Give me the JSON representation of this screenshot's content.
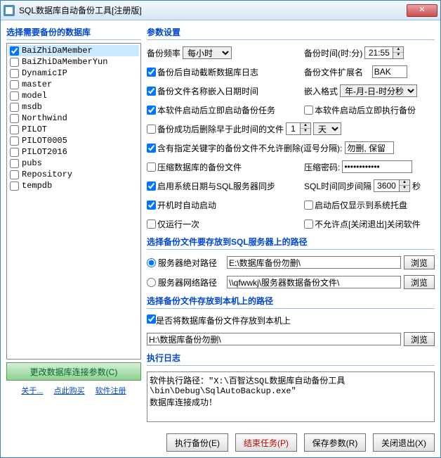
{
  "window": {
    "title": "SQL数据库自动备份工具[注册版]"
  },
  "left": {
    "title": "选择需要备份的数据库",
    "databases": [
      {
        "name": "BaiZhiDaMember",
        "checked": true,
        "selected": true
      },
      {
        "name": "BaiZhiDaMemberYun",
        "checked": false
      },
      {
        "name": "DynamicIP",
        "checked": false
      },
      {
        "name": "master",
        "checked": false
      },
      {
        "name": "model",
        "checked": false
      },
      {
        "name": "msdb",
        "checked": false
      },
      {
        "name": "Northwind",
        "checked": false
      },
      {
        "name": "PILOT",
        "checked": false
      },
      {
        "name": "PILOT0005",
        "checked": false
      },
      {
        "name": "PILOT2016",
        "checked": false
      },
      {
        "name": "pubs",
        "checked": false
      },
      {
        "name": "Repository",
        "checked": false
      },
      {
        "name": "tempdb",
        "checked": false
      }
    ],
    "update_btn": "更改数据库连接参数(C)",
    "links": {
      "about": "关于...",
      "buy": "点此购买",
      "register": "软件注册"
    }
  },
  "params": {
    "title": "参数设置",
    "freq_label": "备份频率",
    "freq_value": "每小时",
    "time_label": "备份时间(时:分)",
    "time_value": "21:55",
    "auto_truncate": "备份后自动截断数据库日志",
    "ext_label": "备份文件扩展名",
    "ext_value": "BAK",
    "embed_datetime": "备份文件名称嵌入日期时间",
    "embed_fmt_label": "嵌入格式",
    "embed_fmt_value": "年-月-日-时分秒",
    "start_backup": "本软件启动后立即启动备份任务",
    "start_exec": "本软件启动后立即执行备份",
    "delete_before": "备份成功后删除早于此时间的文件",
    "delete_count": "1",
    "delete_unit": "天",
    "keyword_exclude": "含有指定关键字的备份文件不允许删除(逗号分隔):",
    "keyword_value": "勿删, 保留",
    "compress": "压缩数据库的备份文件",
    "compress_pwd_label": "压缩密码:",
    "compress_pwd_value": "************",
    "sync_time": "启用系统日期与SQL服务器同步",
    "sync_interval_label": "SQL时间同步间隔",
    "sync_interval_value": "3600",
    "sync_interval_unit": "秒",
    "autostart": "开机时自动启动",
    "tray_only": "启动后仅显示到系统托盘",
    "run_once": "仅运行一次",
    "no_close": "不允许点[关闭退出]关闭软件"
  },
  "server_path": {
    "title": "选择备份文件要存放到SQL服务器上的路径",
    "abs_label": "服务器绝对路径",
    "abs_value": "E:\\数据库备份勿删\\",
    "net_label": "服务器网络路径",
    "net_value": "\\\\qfwwkj\\服务器数据备份文件\\",
    "browse": "浏览"
  },
  "local_path": {
    "title": "选择备份文件存放到本机上的路径",
    "enable": "是否将数据库备份文件存放到本机上",
    "value": "H:\\数据库备份勿删\\",
    "browse": "浏览"
  },
  "log": {
    "title": "执行日志",
    "content": "软件执行路径：\"X:\\百智达SQL数据库自动备份工具\\bin\\Debug\\SqlAutoBackup.exe\"\n数据库连接成功！"
  },
  "buttons": {
    "exec": "执行备份(E)",
    "stop": "结束任务(P)",
    "save": "保存参数(R)",
    "exit": "关闭退出(X)"
  }
}
